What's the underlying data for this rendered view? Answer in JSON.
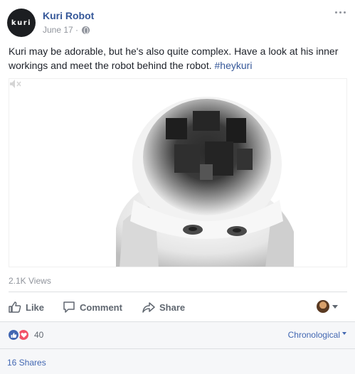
{
  "header": {
    "avatar_text": "kuri",
    "page_name": "Kuri Robot",
    "date": "June 17 ·",
    "privacy_icon": "globe-icon",
    "more_icon": "more-options-icon"
  },
  "post": {
    "text": "Kuri may be adorable, but he's also quite complex. Have a look at his inner workings and meet the robot behind the robot. ",
    "hashtag": "#heykuri"
  },
  "media": {
    "description_icon": "volume-muted-icon"
  },
  "stats": {
    "views": "2.1K Views"
  },
  "actions": {
    "like": "Like",
    "comment": "Comment",
    "share": "Share",
    "like_icon": "thumbs-up-icon",
    "comment_icon": "comment-bubble-icon",
    "share_icon": "share-arrow-icon"
  },
  "reactions": {
    "count": "40",
    "types": [
      "like-reaction-icon",
      "love-reaction-icon"
    ],
    "sort_label": "Chronological",
    "shares": "16 Shares"
  },
  "colors": {
    "link_blue": "#365899",
    "action_gray": "#606770",
    "meta_gray": "#90949c",
    "like_blue": "#4267b2",
    "love_red": "#f25268"
  }
}
